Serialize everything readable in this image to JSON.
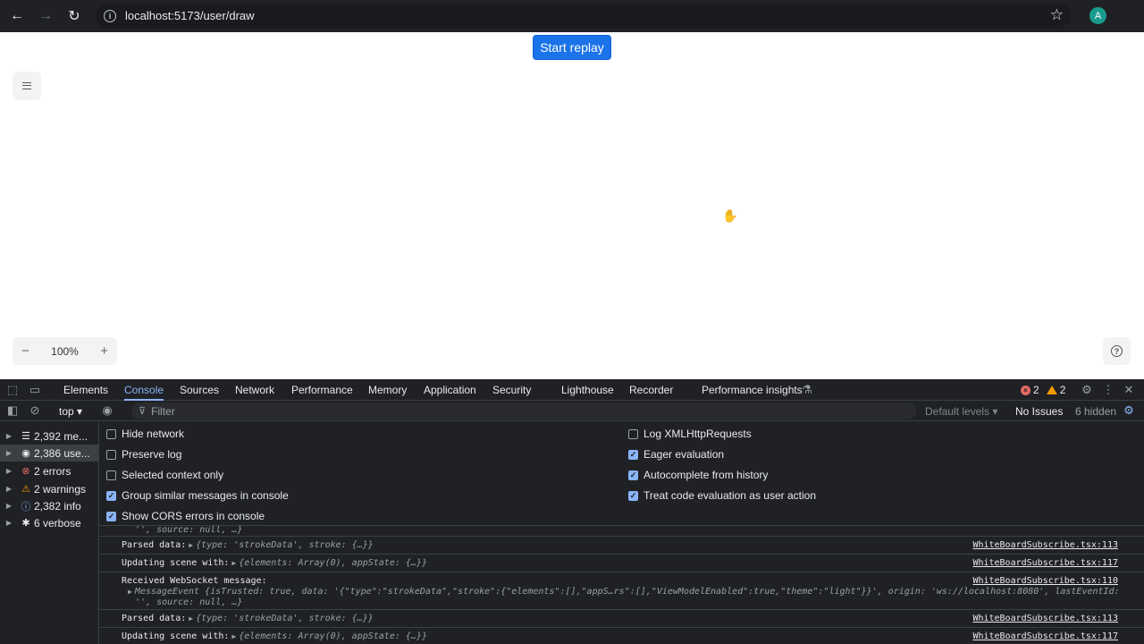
{
  "browser": {
    "url": "localhost:5173/user/draw",
    "avatar_letter": "A"
  },
  "page": {
    "replay_label": "Start replay",
    "zoom": "100%",
    "zoom_minus": "−",
    "zoom_plus": "+"
  },
  "devtools": {
    "tabs": [
      "Elements",
      "Console",
      "Sources",
      "Network",
      "Performance",
      "Memory",
      "Application",
      "Security",
      "Lighthouse",
      "Recorder",
      "Performance insights"
    ],
    "error_count": "2",
    "warning_count": "2",
    "context": "top",
    "filter_placeholder": "Filter",
    "default_levels": "Default levels",
    "no_issues": "No Issues",
    "hidden": "6 hidden",
    "sidebar": [
      {
        "label": "2,392 me...",
        "icon": "list-icon"
      },
      {
        "label": "2,386 use...",
        "icon": "user-icon"
      },
      {
        "label": "2 errors",
        "icon": "error-icon"
      },
      {
        "label": "2 warnings",
        "icon": "warning-icon"
      },
      {
        "label": "2,382 info",
        "icon": "info-icon"
      },
      {
        "label": "6 verbose",
        "icon": "bug-icon"
      }
    ],
    "settings_left": [
      {
        "label": "Hide network",
        "checked": false
      },
      {
        "label": "Preserve log",
        "checked": false
      },
      {
        "label": "Selected context only",
        "checked": false
      },
      {
        "label": "Group similar messages in console",
        "checked": true
      },
      {
        "label": "Show CORS errors in console",
        "checked": true
      }
    ],
    "settings_right": [
      {
        "label": "Log XMLHttpRequests",
        "checked": false
      },
      {
        "label": "Eager evaluation",
        "checked": true
      },
      {
        "label": "Autocomplete from history",
        "checked": true
      },
      {
        "label": "Treat code evaluation as user action",
        "checked": true
      }
    ],
    "console": {
      "row0": "'', source: null, …}",
      "r1_label": "Parsed data:",
      "r1_body": "{type: 'strokeData', stroke: {…}}",
      "r1_src": "WhiteBoardSubscribe.tsx:113",
      "r2_label": "Updating scene with:",
      "r2_body": "{elements: Array(0), appState: {…}}",
      "r2_src": "WhiteBoardSubscribe.tsx:117",
      "r3_label": "Received WebSocket message:",
      "r3_src": "WhiteBoardSubscribe.tsx:110",
      "r3_line2": "MessageEvent {isTrusted: true, data: '{\"type\":\"strokeData\",\"stroke\":{\"elements\":[],\"appS…rs\":[],\"ViewModelEnabled\":true,\"theme\":\"light\"}}', origin: 'ws://localhost:8080', lastEventId:",
      "r3_line3": "'', source: null, …}",
      "r4_label": "Parsed data:",
      "r4_body": "{type: 'strokeData', stroke: {…}}",
      "r4_src": "WhiteBoardSubscribe.tsx:113",
      "r5_label": "Updating scene with:",
      "r5_body": "{elements: Array(0), appState: {…}}",
      "r5_src": "WhiteBoardSubscribe.tsx:117"
    }
  }
}
